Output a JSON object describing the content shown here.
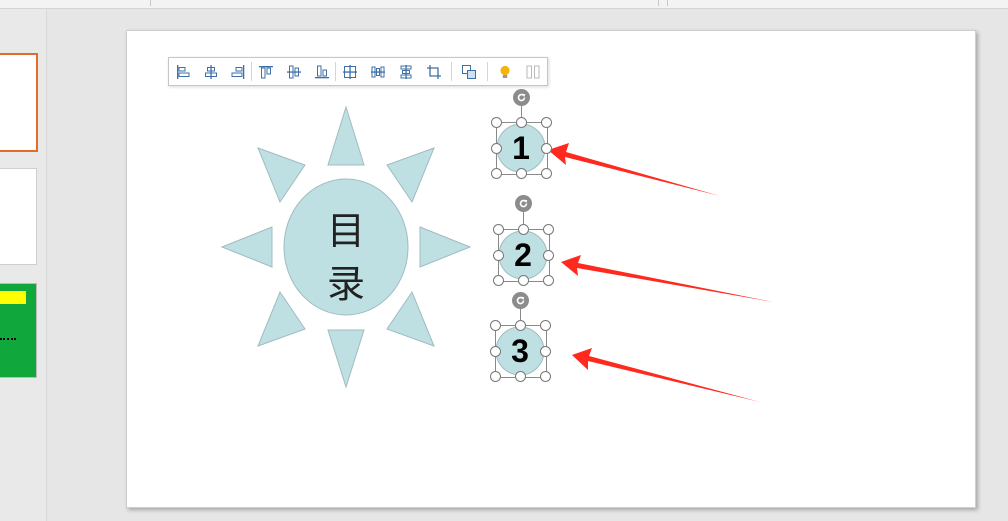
{
  "slide": {
    "title_line1": "目",
    "title_line2": "录",
    "items": [
      {
        "label": "1"
      },
      {
        "label": "2"
      },
      {
        "label": "3"
      }
    ]
  },
  "toolbar": {
    "buttons": [
      {
        "name": "align-left-icon"
      },
      {
        "name": "align-center-icon"
      },
      {
        "name": "align-right-icon"
      },
      {
        "name": "align-top-icon"
      },
      {
        "name": "align-middle-icon"
      },
      {
        "name": "align-bottom-icon"
      },
      {
        "name": "distribute-grid-icon"
      },
      {
        "name": "distribute-horizontal-icon"
      },
      {
        "name": "distribute-vertical-icon"
      },
      {
        "name": "crop-icon"
      },
      {
        "name": "group-icon"
      },
      {
        "name": "lightbulb-icon"
      },
      {
        "name": "more-icon"
      }
    ]
  },
  "colors": {
    "shape_fill": "#bfe0e3",
    "shape_stroke": "#9fbcc0",
    "arrow": "#ff2a1f",
    "thumb_selected_border": "#e46c2a",
    "thumb_green": "#10a83c",
    "thumb_yellow": "#ffff00"
  }
}
